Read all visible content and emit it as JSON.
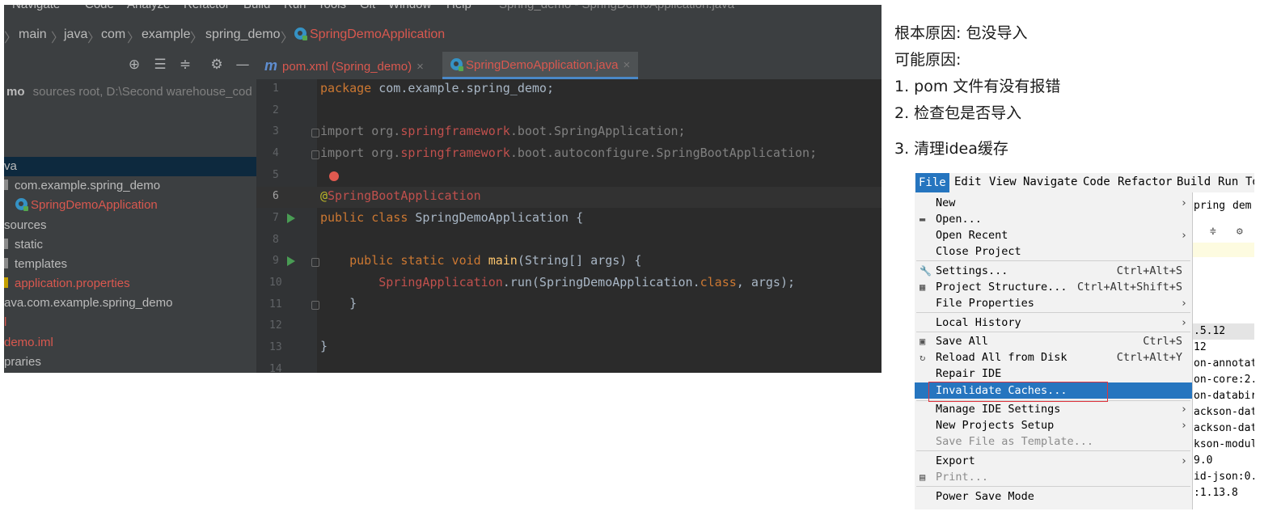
{
  "ide": {
    "menubar": [
      "Navigate",
      "Code",
      "Analyze",
      "Refactor",
      "Build",
      "Run",
      "Tools",
      "Git",
      "Window",
      "Help",
      "Spring_demo - SpringDemoApplication.java"
    ],
    "breadcrumb": [
      "main",
      "java",
      "com",
      "example",
      "spring_demo",
      "SpringDemoApplication"
    ],
    "project_header": {
      "name": "mo",
      "path": "sources root,  D:\\Second warehouse_cod"
    },
    "tree": [
      "",
      "",
      "va",
      "com.example.spring_demo",
      "SpringDemoApplication",
      "sources",
      "static",
      "templates",
      "application.properties",
      "ava.com.example.spring_demo",
      "l",
      "demo.iml",
      "praries"
    ],
    "tabs": [
      {
        "label": "pom.xml (Spring_demo)",
        "active": false
      },
      {
        "label": "SpringDemoApplication.java",
        "active": true
      }
    ],
    "line_numbers": [
      "1",
      "2",
      "3",
      "4",
      "5",
      "6",
      "7",
      "8",
      "9",
      "10",
      "11",
      "12",
      "13",
      "14"
    ],
    "code": {
      "l1_kw": "package",
      "l1_rest": " com.example.spring_demo;",
      "l3_a": "import org.",
      "l3_b": "springframework",
      "l3_c": ".boot.SpringApplication;",
      "l4_a": "import org.",
      "l4_b": "springframework",
      "l4_c": ".boot.autoconfigure.SpringBootApplication;",
      "l6_at": "@",
      "l6_name": "SpringBootApplication",
      "l7_kw": "public class",
      "l7_rest": " SpringDemoApplication {",
      "l9_kw": "    public static void",
      "l9_fn": " main",
      "l9_rest": "(String[] args) {",
      "l10_cls": "        SpringApplication",
      "l10_mid": ".run(SpringDemoApplication.",
      "l10_kw": "class",
      "l10_end": ", args);",
      "l11": "    }",
      "l13": "}"
    }
  },
  "notes": {
    "root_cause": "根本原因: 包没导入",
    "possible": "可能原因:",
    "step1": "1. pom 文件有没有报错",
    "step2": "2. 检查包是否导入",
    "step3": "3. 清理idea缓存"
  },
  "menu": {
    "menubar": [
      "File",
      "Edit",
      "View",
      "Navigate",
      "Code",
      "Refactor",
      "Build",
      "Run",
      "To"
    ],
    "items": [
      {
        "label": "New",
        "shortcut": "",
        "submenu": true
      },
      {
        "label": "Open...",
        "shortcut": "",
        "submenu": false
      },
      {
        "label": "Open Recent",
        "shortcut": "",
        "submenu": true
      },
      {
        "label": "Close Project",
        "shortcut": "",
        "submenu": false
      },
      {
        "label": "Settings...",
        "shortcut": "Ctrl+Alt+S",
        "submenu": false
      },
      {
        "label": "Project Structure...",
        "shortcut": "Ctrl+Alt+Shift+S",
        "submenu": false
      },
      {
        "label": "File Properties",
        "shortcut": "",
        "submenu": true
      },
      {
        "label": "Local History",
        "shortcut": "",
        "submenu": true
      },
      {
        "label": "Save All",
        "shortcut": "Ctrl+S",
        "submenu": false
      },
      {
        "label": "Reload All from Disk",
        "shortcut": "Ctrl+Alt+Y",
        "submenu": false
      },
      {
        "label": "Repair IDE",
        "shortcut": "",
        "submenu": false
      },
      {
        "label": "Invalidate Caches...",
        "shortcut": "",
        "submenu": false
      },
      {
        "label": "Manage IDE Settings",
        "shortcut": "",
        "submenu": true
      },
      {
        "label": "New Projects Setup",
        "shortcut": "",
        "submenu": true
      },
      {
        "label": "Save File as Template...",
        "shortcut": "",
        "submenu": false
      },
      {
        "label": "Export",
        "shortcut": "",
        "submenu": true
      },
      {
        "label": "Print...",
        "shortcut": "",
        "submenu": false
      },
      {
        "label": "Power Save Mode",
        "shortcut": "",
        "submenu": false
      }
    ],
    "background": [
      "pring",
      "dem",
      ".5.12",
      "12",
      "on-annotat",
      "on-core:2.",
      "on-databir",
      "ackson-dat",
      "ackson-dat",
      "kson-modul",
      "9.0",
      "id-json:0.",
      ":1.13.8"
    ]
  },
  "colors": {
    "highlight": "#2675bf",
    "redbox": "#e0343e",
    "ide_bg": "#2b2b2b"
  }
}
